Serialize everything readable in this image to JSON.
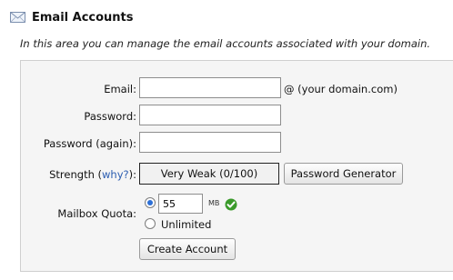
{
  "header": {
    "title": "Email Accounts",
    "description": "In this area you can manage the email accounts associated with your domain.",
    "icon": "mail-envelope-icon"
  },
  "form": {
    "email_label": "Email:",
    "email_value": "",
    "email_suffix": "@ (your domain.com)",
    "password_label": "Password:",
    "password_value": "",
    "password_again_label": "Password (again):",
    "password_again_value": "",
    "strength_label_prefix": "Strength (",
    "strength_why_link": "why?",
    "strength_label_suffix": "):",
    "strength_value": "Very Weak (0/100)",
    "password_generator_button": "Password Generator",
    "quota_label": "Mailbox Quota:",
    "quota_value": "55",
    "quota_unit": "MB",
    "quota_valid_icon": "check-circle-icon",
    "quota_limited_selected": true,
    "unlimited_label": "Unlimited",
    "create_button": "Create Account"
  },
  "colors": {
    "link": "#2a5cb0",
    "radio_selected": "#2c6fd6",
    "check_green": "#3a9a2a",
    "panel_bg": "#f5f5f5"
  }
}
